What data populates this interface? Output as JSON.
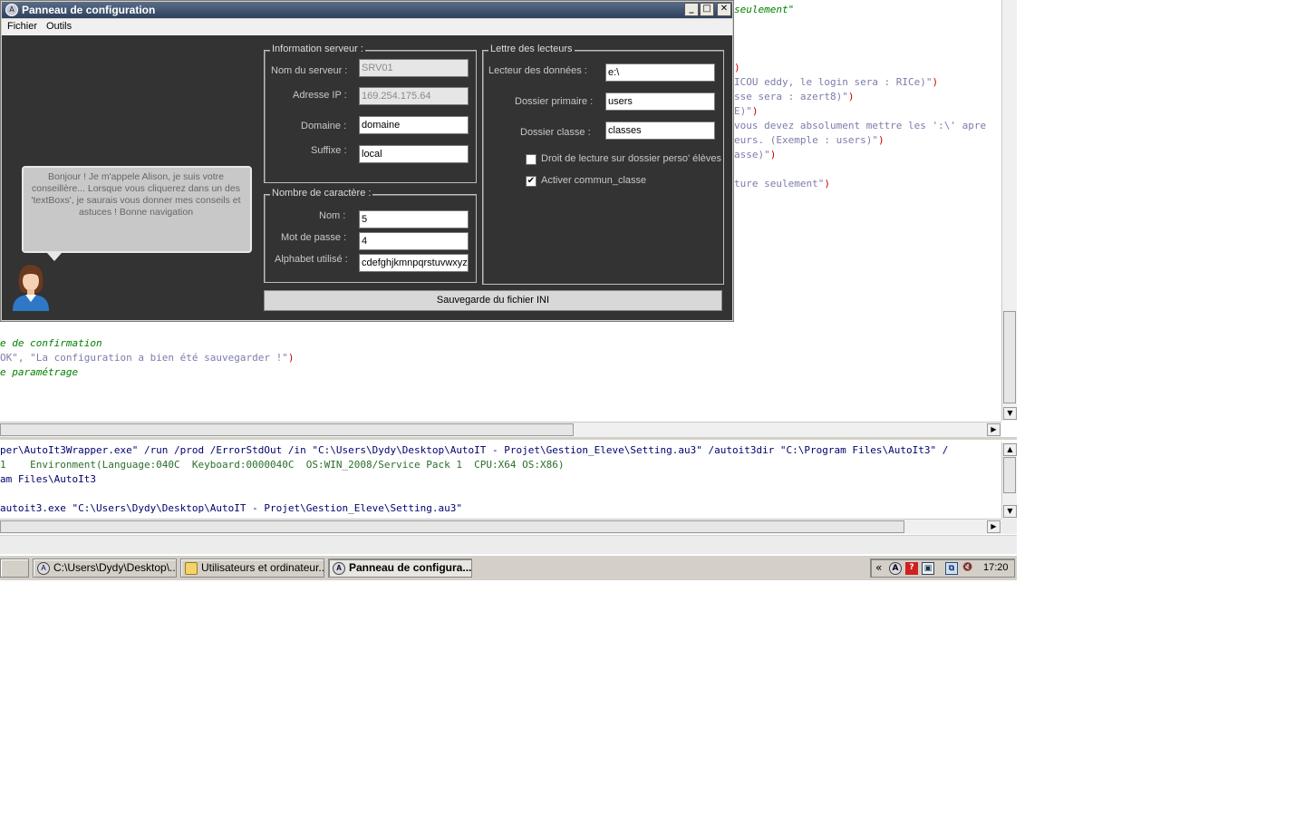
{
  "editor": {
    "top_lines": [
      {
        "text": "seulement\"",
        "cls": "c-green"
      },
      {
        "text": ")",
        "cls": "c-red"
      },
      {
        "text": "ICOU eddy, le login sera : RICe)\"",
        "cls": "c-str",
        "tail": ")"
      },
      {
        "text": "sse sera : azert8)\"",
        "cls": "c-str",
        "tail": ")"
      },
      {
        "text": "E)\"",
        "cls": "c-str",
        "tail": ")"
      },
      {
        "text": "vous devez absolument mettre les ':\\' apre",
        "cls": "c-str"
      },
      {
        "text": "eurs. (Exemple : users)\"",
        "cls": "c-str",
        "tail": ")"
      },
      {
        "text": "asse)\"",
        "cls": "c-str",
        "tail": ")"
      },
      {
        "text": "ture seulement\"",
        "cls": "c-str",
        "tail": ")"
      }
    ],
    "bottom_lines": [
      {
        "text": "e de confirmation",
        "cls": "c-green"
      },
      {
        "text": "OK\", \"La configuration a bien été sauvegarder !\"",
        "cls": "c-str",
        "tail": ")"
      },
      {
        "text": "e paramétrage",
        "cls": "c-green"
      }
    ]
  },
  "output": {
    "lines": [
      {
        "text": "per\\AutoIt3Wrapper.exe\" /run /prod /ErrorStdOut /in \"C:\\Users\\Dydy\\Desktop\\AutoIT - Projet\\Gestion_Eleve\\Setting.au3\" /autoit3dir \"C:\\Program Files\\AutoIt3\" /",
        "cls": "c-blue"
      },
      {
        "text": "1    Environment(Language:040C  Keyboard:0000040C  OS:WIN_2008/Service Pack 1  CPU:X64 OS:X86)",
        "cls": "c-green-plain"
      },
      {
        "text": "am Files\\AutoIt3",
        "cls": "c-blue"
      },
      {
        "text": "",
        "cls": "c-blue"
      },
      {
        "text": "autoit3.exe \"C:\\Users\\Dydy\\Desktop\\AutoIT - Projet\\Gestion_Eleve\\Setting.au3\"",
        "cls": "c-blue"
      }
    ]
  },
  "dialog": {
    "title": "Panneau de configuration",
    "menu": [
      "Fichier",
      "Outils"
    ],
    "assistant_message": "Bonjour ! Je m'appele Alison, je suis votre conseillère... Lorsque vous cliquerez dans un des 'textBoxs', je saurais vous donner mes conseils et astuces ! Bonne navigation",
    "server_group": {
      "legend": "Information serveur :",
      "server_name_label": "Nom du serveur :",
      "server_name_value": "SRV01",
      "ip_label": "Adresse IP :",
      "ip_value": "169.254.175.64",
      "domain_label": "Domaine :",
      "domain_value": "domaine",
      "suffix_label": "Suffixe :",
      "suffix_value": "local"
    },
    "chars_group": {
      "legend": "Nombre de caractère :",
      "name_label": "Nom :",
      "name_value": "5",
      "password_label": "Mot de passe :",
      "password_value": "4",
      "alphabet_label": "Alphabet utilisé :",
      "alphabet_value": "cdefghjkmnpqrstuvwxyz"
    },
    "drives_group": {
      "legend": "Lettre des lecteurs",
      "data_drive_label": "Lecteur des données :",
      "data_drive_value": "e:\\",
      "primary_folder_label": "Dossier primaire :",
      "primary_folder_value": "users",
      "class_folder_label": "Dossier classe :",
      "class_folder_value": "classes",
      "read_right_label": "Droit de lecture sur dossier perso' élèves",
      "read_right_checked": false,
      "commun_label": "Activer commun_classe",
      "commun_checked": true
    },
    "save_button": "Sauvegarde du fichier INI"
  },
  "taskbar": {
    "tasks": [
      {
        "label": "C:\\Users\\Dydy\\Desktop\\...",
        "active": false,
        "icon": "autoit-icon"
      },
      {
        "label": "Utilisateurs et ordinateur...",
        "active": false,
        "icon": "folder-icon"
      },
      {
        "label": "Panneau de configura...",
        "active": true,
        "icon": "autoit-icon"
      }
    ],
    "tray_chevron": "«",
    "clock": "17:20"
  }
}
